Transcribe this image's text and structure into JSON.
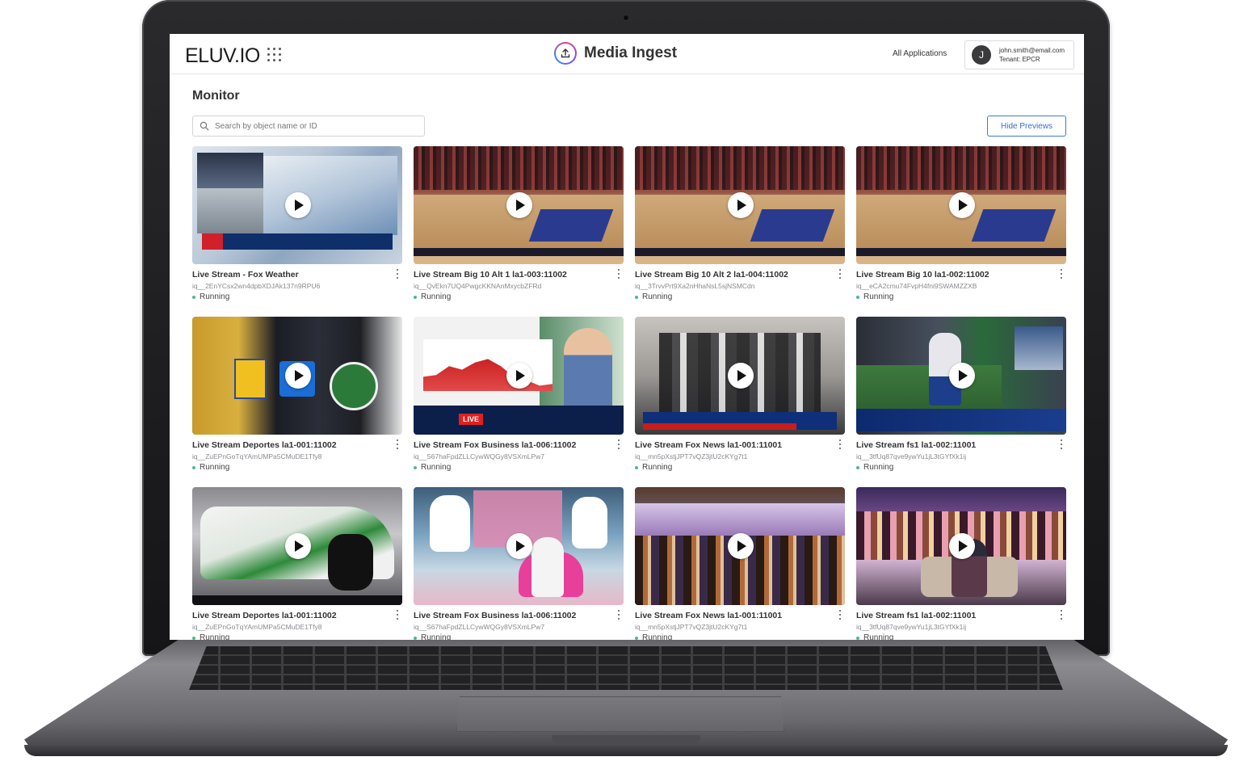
{
  "header": {
    "logo": "ELUV.IO",
    "app_title": "Media Ingest",
    "all_applications": "All Applications",
    "user": {
      "initial": "J",
      "email": "john.smith@email.com",
      "tenant": "Tenant: EPCR"
    }
  },
  "main": {
    "page_title": "Monitor",
    "search_placeholder": "Search by object name or ID",
    "hide_previews_label": "Hide Previews"
  },
  "streams": [
    {
      "title": "Live Stream - Fox Weather",
      "id": "iq__2EnYCsx2wn4dpbXDJAk137n9RPU6",
      "status": "Running",
      "scene": "weather"
    },
    {
      "title": "Live Stream Big 10 Alt 1 la1-003:11002",
      "id": "iq__QvEkn7UQ4PwgcKKNAnMxycbZFRd",
      "status": "Running",
      "scene": "court"
    },
    {
      "title": "Live Stream Big 10 Alt 2 la1-004:11002",
      "id": "iq__3TrvvPrt9Xa2nHhaNsL5sjNSMCdn",
      "status": "Running",
      "scene": "court"
    },
    {
      "title": "Live Stream Big 10 la1-002:11002",
      "id": "iq__eCA2cmu74FvpH4fni9SWAMZZXB",
      "status": "Running",
      "scene": "court"
    },
    {
      "title": "Live Stream Deportes la1-001:11002",
      "id": "iq__ZuEPnGoTqYAmUMPa5CMuDE1Tfy8",
      "status": "Running",
      "scene": "soccer"
    },
    {
      "title": "Live Stream Fox Business la1-006:11002",
      "id": "iq__S67haFpdZLLCywWQGy8VSXmLPw7",
      "status": "Running",
      "scene": "nasdaq"
    },
    {
      "title": "Live Stream Fox News la1-001:11001",
      "id": "iq__mn5pXstjJPT7vQZ3jtU2cKYg7t1",
      "status": "Running",
      "scene": "news"
    },
    {
      "title": "Live Stream fs1 la1-002:11001",
      "id": "iq__3tfUq87qve9ywYu1jL3tGYfXk1ij",
      "status": "Running",
      "scene": "baseball"
    },
    {
      "title": "Live Stream Deportes la1-001:11002",
      "id": "iq__ZuEPnGoTqYAmUMPa5CMuDE1Tfy8",
      "status": "Running",
      "scene": "race"
    },
    {
      "title": "Live Stream Fox Business la1-006:11002",
      "id": "iq__S67haFpdZLLCywWQGy8VSXmLPw7",
      "status": "Running",
      "scene": "talk1"
    },
    {
      "title": "Live Stream Fox News la1-001:11001",
      "id": "iq__mn5pXstjJPT7vQZ3jtU2cKYg7t1",
      "status": "Running",
      "scene": "talk2"
    },
    {
      "title": "Live Stream fs1 la1-002:11001",
      "id": "iq__3tfUq87qve9ywYu1jL3tGYfXk1ij",
      "status": "Running",
      "scene": "talk3"
    }
  ],
  "thumbnail_overlays": {
    "live_badge": "LIVE"
  },
  "colors": {
    "accent": "#3a7bd5",
    "status_running": "#4cb98a"
  }
}
